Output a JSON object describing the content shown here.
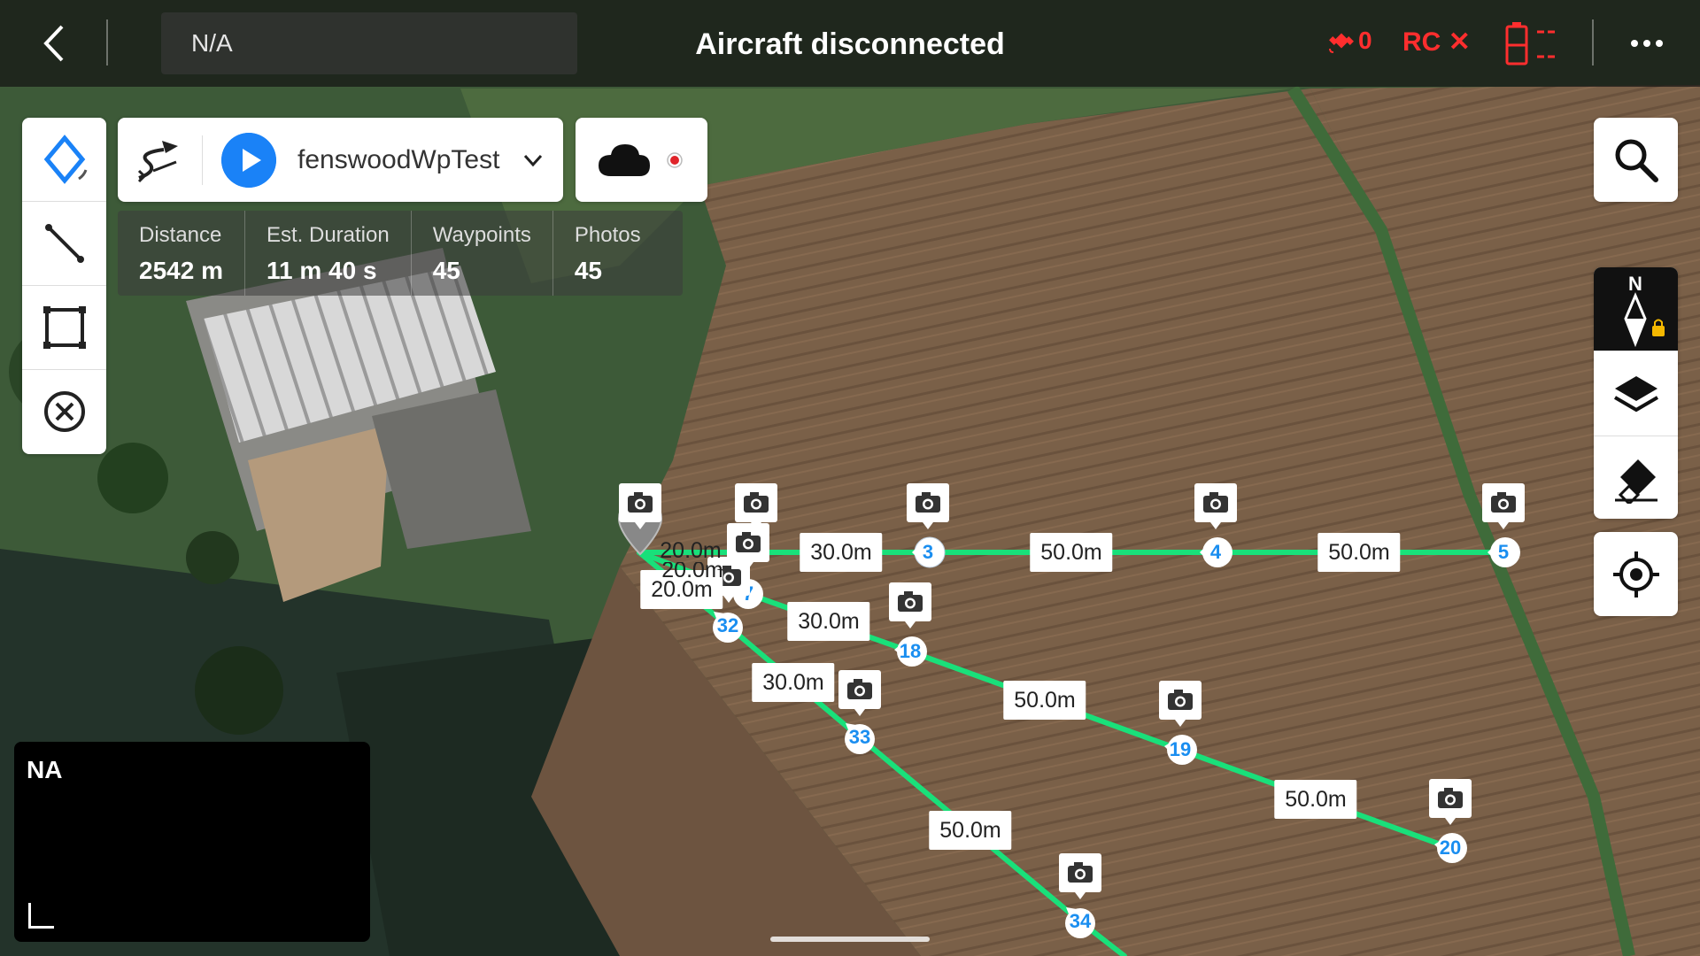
{
  "topbar": {
    "flight_mode": "N/A",
    "status": "Aircraft disconnected",
    "signal_count": "0",
    "rc_label": "RC",
    "rc_x": "✕",
    "battery_dashes": "- -",
    "colors": {
      "alert": "#ff2e2e"
    }
  },
  "mission": {
    "name": "fenswoodWpTest"
  },
  "stats": [
    {
      "label": "Distance",
      "value": "2542 m"
    },
    {
      "label": "Est. Duration",
      "value": "11 m 40 s"
    },
    {
      "label": "Waypoints",
      "value": "45"
    },
    {
      "label": "Photos",
      "value": "45"
    }
  ],
  "tools": [
    "waypoint-tool",
    "line-tool",
    "area-tool",
    "clear-tool"
  ],
  "right_controls": [
    "search",
    "compass-north",
    "map-layers",
    "eraser",
    "locate"
  ],
  "compass_label": "N",
  "mini_view": {
    "label": "NA"
  },
  "waypoints": [
    {
      "num": "3"
    },
    {
      "num": "4"
    },
    {
      "num": "5"
    },
    {
      "num": "18"
    },
    {
      "num": "19"
    },
    {
      "num": "20"
    },
    {
      "num": "32"
    },
    {
      "num": "33"
    },
    {
      "num": "34"
    },
    {
      "num": "7"
    }
  ],
  "distance_labels": [
    "30.0m",
    "50.0m",
    "50.0m",
    "30.0m",
    "50.0m",
    "50.0m",
    "30.0m",
    "50.0m",
    "20.0m",
    "20.0m",
    "20.0m"
  ],
  "colors": {
    "route": "#19e07a",
    "accent": "#1a82f7",
    "waypoint_num": "#1a8ef0"
  }
}
